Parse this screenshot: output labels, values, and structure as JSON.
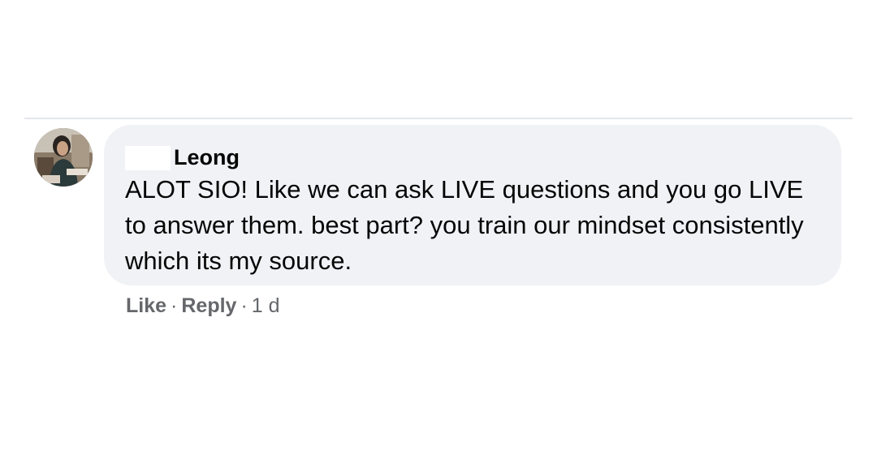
{
  "comment": {
    "author_name": "Leong",
    "text": "ALOT SIO! Like we can ask LIVE questions and you go LIVE to answer them. best part? you train our mindset consistently which its my source.",
    "actions": {
      "like_label": "Like",
      "separator": "·",
      "reply_label": "Reply",
      "timestamp": "1 d"
    }
  },
  "colors": {
    "bubble_background": "#f0f2f5",
    "text_primary": "#050505",
    "text_secondary": "#65676b",
    "divider": "#e4e6eb"
  }
}
